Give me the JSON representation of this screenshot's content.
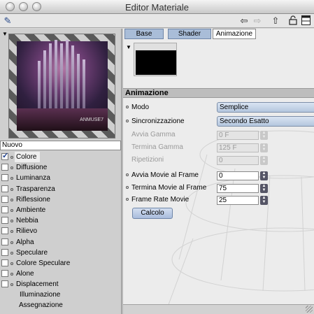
{
  "window": {
    "title": "Editor Materiale"
  },
  "left": {
    "name_value": "Nuovo",
    "channels": [
      {
        "label": "Colore",
        "checked": true,
        "selected": true
      },
      {
        "label": "Diffusione",
        "checked": false
      },
      {
        "label": "Luminanza",
        "checked": false
      },
      {
        "label": "Trasparenza",
        "checked": false
      },
      {
        "label": "Riflessione",
        "checked": false
      },
      {
        "label": "Ambiente",
        "checked": false
      },
      {
        "label": "Nebbia",
        "checked": false
      },
      {
        "label": "Rilievo",
        "checked": false
      },
      {
        "label": "Alpha",
        "checked": false
      },
      {
        "label": "Speculare",
        "checked": false
      },
      {
        "label": "Colore Speculare",
        "checked": false
      },
      {
        "label": "Alone",
        "checked": false
      },
      {
        "label": "Displacement",
        "checked": false
      }
    ],
    "extra_items": [
      "Illuminazione",
      "Assegnazione"
    ],
    "preview_watermark": "ANMUSE7"
  },
  "tabs": [
    "Base",
    "Shader",
    "Animazione"
  ],
  "section": {
    "title": "Animazione",
    "modo_label": "Modo",
    "modo_value": "Semplice",
    "sync_label": "Sincronizzazione",
    "sync_value": "Secondo Esatto",
    "avvia_gamma_label": "Avvia Gamma",
    "avvia_gamma_value": "0 F",
    "termina_gamma_label": "Termina Gamma",
    "termina_gamma_value": "125 F",
    "ripetizioni_label": "Ripetizioni",
    "ripetizioni_value": "0",
    "avvia_movie_label": "Avvia Movie al Frame",
    "avvia_movie_value": "0",
    "termina_movie_label": "Termina Movie al Frame",
    "termina_movie_value": "75",
    "frame_rate_label": "Frame Rate Movie",
    "frame_rate_value": "25",
    "calcolo_label": "Calcolo"
  },
  "icons": {
    "tool": "wand-icon",
    "back": "arrow-left-icon",
    "forward": "arrow-right-icon",
    "up": "arrow-up-icon",
    "lock": "lock-icon",
    "layout": "window-layout-icon"
  }
}
